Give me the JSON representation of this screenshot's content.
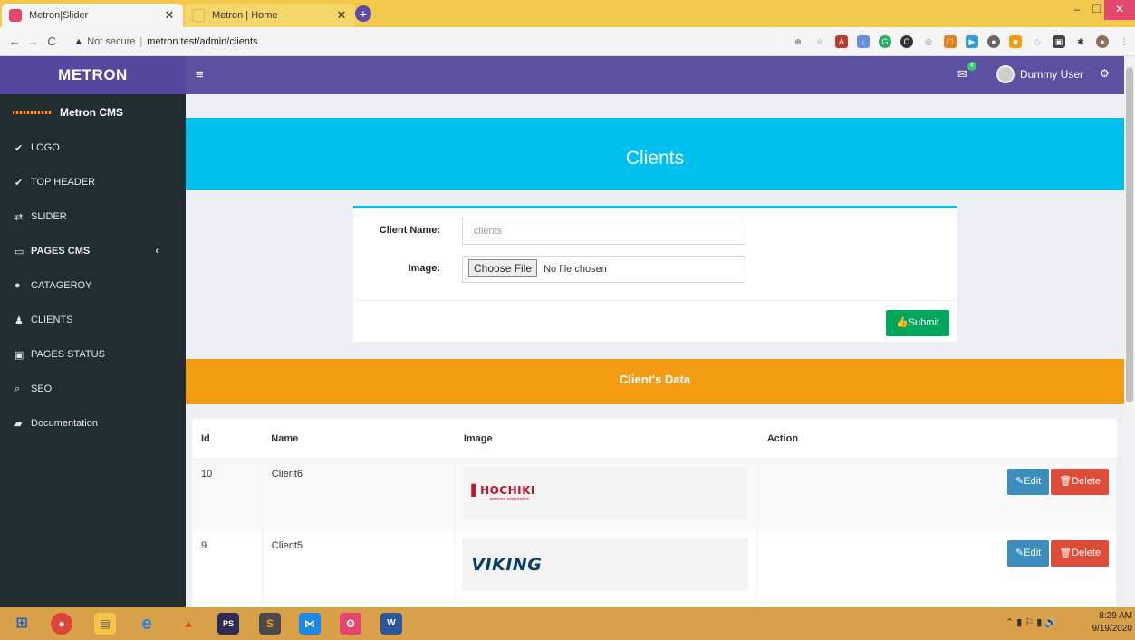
{
  "browser": {
    "tabs": [
      {
        "title": "Metron|Slider",
        "active": true,
        "icon": "metron-favicon"
      },
      {
        "title": "Metron | Home",
        "active": false,
        "icon": "metron-favicon"
      }
    ],
    "new_tab": "+",
    "security": "Not secure",
    "url": "metron.test/admin/clients"
  },
  "header": {
    "brand": "METRON",
    "menu_icon": "≡",
    "mail_badge": "4",
    "user_name": "Dummy User"
  },
  "sidebar": {
    "title": "Metron CMS",
    "items": [
      {
        "label": "LOGO",
        "icon": "check-circle-icon"
      },
      {
        "label": "TOP HEADER",
        "icon": "check-circle-icon"
      },
      {
        "label": "SLIDER",
        "icon": "exchange-icon"
      },
      {
        "label": "PAGES CMS",
        "icon": "laptop-icon"
      },
      {
        "label": "CATAGEROY",
        "icon": "circle-icon"
      },
      {
        "label": "CLIENTS",
        "icon": "male-icon"
      },
      {
        "label": "PAGES STATUS",
        "icon": "image-icon"
      },
      {
        "label": "SEO",
        "icon": "search-icon"
      },
      {
        "label": "Documentation",
        "icon": "book-icon"
      }
    ]
  },
  "page": {
    "title": "Clients",
    "form": {
      "client_name_label": "Client Name:",
      "client_name_placeholder": "clients",
      "image_label": "Image:",
      "choose_file": "Choose File",
      "no_file": "No file chosen",
      "submit": "Submit"
    },
    "data_title": "Client's Data",
    "table": {
      "headers": [
        "Id",
        "Name",
        "Image",
        "Action"
      ],
      "rows": [
        {
          "id": "10",
          "name": "Client6",
          "logo": "HOCHIKI",
          "logo_sub": "america corporation"
        },
        {
          "id": "9",
          "name": "Client5",
          "logo": "VIKING"
        }
      ],
      "edit_label": "Edit",
      "delete_label": "Delete"
    }
  },
  "taskbar": {
    "time": "8:29 AM",
    "date": "9/19/2020"
  },
  "colors": {
    "header": "#5c50a0",
    "sidebar": "#222d32",
    "banner": "#00c0ef",
    "data_bar": "#f39c12",
    "submit": "#00a65a",
    "edit": "#3c8dbc",
    "delete": "#dd4b39"
  }
}
